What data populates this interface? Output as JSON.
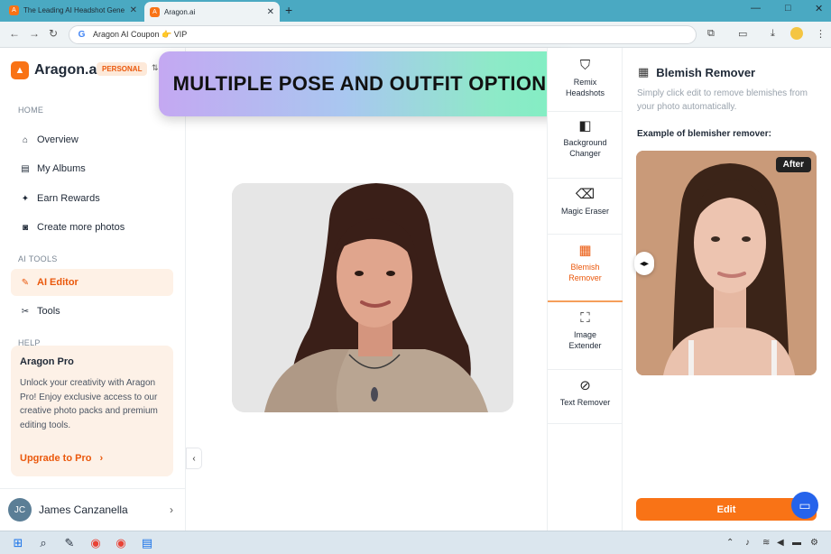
{
  "browser": {
    "tabs": [
      {
        "title": "The Leading AI Headshot Gene",
        "favicon": "A",
        "active": false
      },
      {
        "title": "Aragon.ai",
        "favicon": "A",
        "active": true
      }
    ],
    "address": "Aragon AI Coupon 👉 VIP",
    "window_controls": [
      "—",
      "□",
      "✕"
    ]
  },
  "sidebar": {
    "brand": "Aragon.ai",
    "plan": "PERSONAL",
    "sections": {
      "home": "HOME",
      "ai_tools": "AI TOOLS",
      "help": "HELP"
    },
    "nav": [
      {
        "label": "Overview",
        "icon": "home-icon",
        "glyph": "⌂"
      },
      {
        "label": "My Albums",
        "icon": "album-icon",
        "glyph": "▤"
      },
      {
        "label": "Earn Rewards",
        "icon": "gift-icon",
        "glyph": "🎁"
      },
      {
        "label": "Create more photos",
        "icon": "camera-icon",
        "glyph": "◙"
      },
      {
        "label": "AI Editor",
        "icon": "magic-wand-icon",
        "glyph": "✎"
      },
      {
        "label": "Tools",
        "icon": "tools-icon",
        "glyph": "✂"
      }
    ],
    "promo": {
      "title": "Aragon Pro",
      "body": "Unlock your creativity with Aragon Pro! Enjoy exclusive access to our creative photo packs and premium editing tools.",
      "link": "Upgrade to Pro",
      "link_arrow": "›"
    },
    "user": {
      "initials": "JC",
      "name": "James Canzanella"
    }
  },
  "banner": {
    "text": "MULTIPLE POSE AND OUTFIT OPTIONS"
  },
  "tools": [
    {
      "label": "Remix Headshots",
      "icon": "shirt-icon",
      "glyph": "👕",
      "active": false
    },
    {
      "label": "Background Changer",
      "icon": "background-icon",
      "glyph": "◧",
      "active": false
    },
    {
      "label": "Magic Eraser",
      "icon": "eraser-icon",
      "glyph": "⌫",
      "active": false
    },
    {
      "label": "Blemish Remover",
      "icon": "blemish-icon",
      "glyph": "▦",
      "active": true
    },
    {
      "label": "Image Extender",
      "icon": "extend-icon",
      "glyph": "⛶",
      "active": false
    },
    {
      "label": "Text Remover",
      "icon": "text-remove-icon",
      "glyph": "Ⓐ",
      "active": false
    }
  ],
  "panel": {
    "title": "Blemish Remover",
    "description": "Simply click edit to remove blemishes from your photo automatically.",
    "example_label": "Example of blemisher remover:",
    "after_badge": "After",
    "edit_button": "Edit"
  },
  "colors": {
    "accent": "#f97316",
    "accent_soft": "#fef1e6",
    "chat": "#2563eb"
  }
}
